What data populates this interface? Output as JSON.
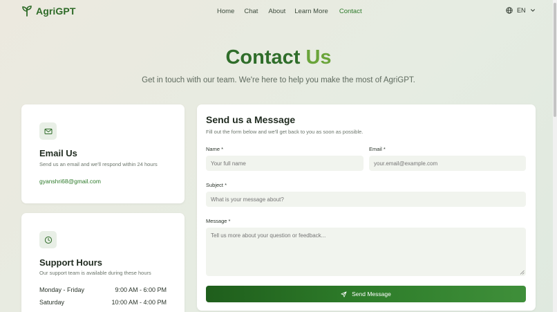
{
  "brand": {
    "name": "AgriGPT",
    "icon": "sprout-icon"
  },
  "nav": {
    "links": [
      "Home",
      "Chat",
      "About",
      "Learn More",
      "Contact"
    ],
    "active": "Contact",
    "language": "EN"
  },
  "hero": {
    "title_part1": "Contact",
    "title_part2": "Us",
    "subtitle": "Get in touch with our team. We're here to help you make the most of AgriGPT."
  },
  "email_card": {
    "icon": "mail-icon",
    "title": "Email Us",
    "description": "Send us an email and we'll respond within 24 hours",
    "email": "gyanshri68@gmail.com"
  },
  "support_card": {
    "icon": "clock-icon",
    "title": "Support Hours",
    "description": "Our support team is available during these hours",
    "rows": [
      {
        "day": "Monday - Friday",
        "time": "9:00 AM - 6:00 PM"
      },
      {
        "day": "Saturday",
        "time": "10:00 AM - 4:00 PM"
      }
    ]
  },
  "form": {
    "title": "Send us a Message",
    "description": "Fill out the form below and we'll get back to you as soon as possible.",
    "name_label": "Name *",
    "name_placeholder": "Your full name",
    "email_label": "Email *",
    "email_placeholder": "your.email@example.com",
    "subject_label": "Subject *",
    "subject_placeholder": "What is your message about?",
    "message_label": "Message *",
    "message_placeholder": "Tell us more about your question or feedback...",
    "submit_label": "Send Message",
    "submit_icon": "send-icon"
  },
  "colors": {
    "brand_green": "#2d6a27",
    "accent_light_green": "#6aa43a",
    "button_green": "#2e7d2a"
  }
}
